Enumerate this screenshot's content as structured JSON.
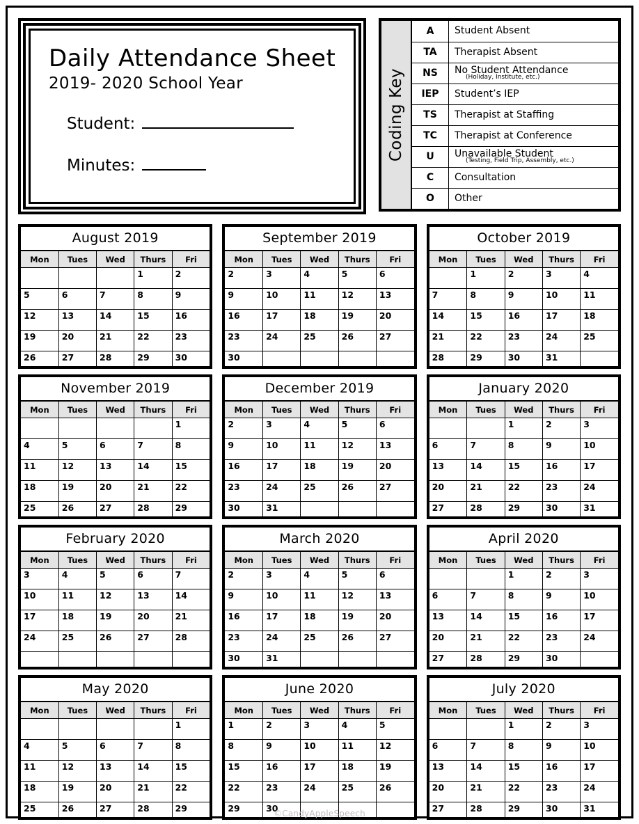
{
  "document": {
    "title": "Daily Attendance Sheet",
    "subtitle": "2019- 2020 School Year",
    "fields": {
      "student_label": "Student:",
      "minutes_label": "Minutes:"
    },
    "footer_credit": "©CandyAppleSpeech"
  },
  "coding_key": {
    "sidebar_label": "Coding Key",
    "rows": [
      {
        "code": "A",
        "description": "Student Absent",
        "sub": ""
      },
      {
        "code": "TA",
        "description": "Therapist Absent",
        "sub": ""
      },
      {
        "code": "NS",
        "description": "No Student Attendance",
        "sub": "(Holiday, Institute, etc.)"
      },
      {
        "code": "IEP",
        "description": "Student’s IEP",
        "sub": ""
      },
      {
        "code": "TS",
        "description": "Therapist at Staffing",
        "sub": ""
      },
      {
        "code": "TC",
        "description": "Therapist at Conference",
        "sub": ""
      },
      {
        "code": "U",
        "description": "Unavailable Student",
        "sub": "(Testing, Field Trip, Assembly, etc.)"
      },
      {
        "code": "C",
        "description": "Consultation",
        "sub": ""
      },
      {
        "code": "O",
        "description": "Other",
        "sub": ""
      }
    ]
  },
  "calendars": {
    "weekday_headers": [
      "Mon",
      "Tues",
      "Wed",
      "Thurs",
      "Fri"
    ],
    "months": [
      {
        "title": "August 2019",
        "weeks": [
          [
            "",
            "",
            "",
            "1",
            "2"
          ],
          [
            "5",
            "6",
            "7",
            "8",
            "9"
          ],
          [
            "12",
            "13",
            "14",
            "15",
            "16"
          ],
          [
            "19",
            "20",
            "21",
            "22",
            "23"
          ],
          [
            "26",
            "27",
            "28",
            "29",
            "30"
          ]
        ]
      },
      {
        "title": "September 2019",
        "weeks": [
          [
            "2",
            "3",
            "4",
            "5",
            "6"
          ],
          [
            "9",
            "10",
            "11",
            "12",
            "13"
          ],
          [
            "16",
            "17",
            "18",
            "19",
            "20"
          ],
          [
            "23",
            "24",
            "25",
            "26",
            "27"
          ],
          [
            "30",
            "",
            "",
            "",
            ""
          ]
        ]
      },
      {
        "title": "October 2019",
        "weeks": [
          [
            "",
            "1",
            "2",
            "3",
            "4"
          ],
          [
            "7",
            "8",
            "9",
            "10",
            "11"
          ],
          [
            "14",
            "15",
            "16",
            "17",
            "18"
          ],
          [
            "21",
            "22",
            "23",
            "24",
            "25"
          ],
          [
            "28",
            "29",
            "30",
            "31",
            ""
          ]
        ]
      },
      {
        "title": "November 2019",
        "weeks": [
          [
            "",
            "",
            "",
            "",
            "1"
          ],
          [
            "4",
            "5",
            "6",
            "7",
            "8"
          ],
          [
            "11",
            "12",
            "13",
            "14",
            "15"
          ],
          [
            "18",
            "19",
            "20",
            "21",
            "22"
          ],
          [
            "25",
            "26",
            "27",
            "28",
            "29"
          ]
        ]
      },
      {
        "title": "December 2019",
        "weeks": [
          [
            "2",
            "3",
            "4",
            "5",
            "6"
          ],
          [
            "9",
            "10",
            "11",
            "12",
            "13"
          ],
          [
            "16",
            "17",
            "18",
            "19",
            "20"
          ],
          [
            "23",
            "24",
            "25",
            "26",
            "27"
          ],
          [
            "30",
            "31",
            "",
            "",
            ""
          ]
        ]
      },
      {
        "title": "January 2020",
        "weeks": [
          [
            "",
            "",
            "1",
            "2",
            "3"
          ],
          [
            "6",
            "7",
            "8",
            "9",
            "10"
          ],
          [
            "13",
            "14",
            "15",
            "16",
            "17"
          ],
          [
            "20",
            "21",
            "22",
            "23",
            "24"
          ],
          [
            "27",
            "28",
            "29",
            "30",
            "31"
          ]
        ]
      },
      {
        "title": "February 2020",
        "weeks": [
          [
            "3",
            "4",
            "5",
            "6",
            "7"
          ],
          [
            "10",
            "11",
            "12",
            "13",
            "14"
          ],
          [
            "17",
            "18",
            "19",
            "20",
            "21"
          ],
          [
            "24",
            "25",
            "26",
            "27",
            "28"
          ],
          [
            "",
            "",
            "",
            "",
            ""
          ]
        ]
      },
      {
        "title": "March 2020",
        "weeks": [
          [
            "2",
            "3",
            "4",
            "5",
            "6"
          ],
          [
            "9",
            "10",
            "11",
            "12",
            "13"
          ],
          [
            "16",
            "17",
            "18",
            "19",
            "20"
          ],
          [
            "23",
            "24",
            "25",
            "26",
            "27"
          ],
          [
            "30",
            "31",
            "",
            "",
            ""
          ]
        ]
      },
      {
        "title": "April 2020",
        "weeks": [
          [
            "",
            "",
            "1",
            "2",
            "3"
          ],
          [
            "6",
            "7",
            "8",
            "9",
            "10"
          ],
          [
            "13",
            "14",
            "15",
            "16",
            "17"
          ],
          [
            "20",
            "21",
            "22",
            "23",
            "24"
          ],
          [
            "27",
            "28",
            "29",
            "30",
            ""
          ]
        ]
      },
      {
        "title": "May 2020",
        "weeks": [
          [
            "",
            "",
            "",
            "",
            "1"
          ],
          [
            "4",
            "5",
            "6",
            "7",
            "8"
          ],
          [
            "11",
            "12",
            "13",
            "14",
            "15"
          ],
          [
            "18",
            "19",
            "20",
            "21",
            "22"
          ],
          [
            "25",
            "26",
            "27",
            "28",
            "29"
          ]
        ]
      },
      {
        "title": "June 2020",
        "weeks": [
          [
            "1",
            "2",
            "3",
            "4",
            "5"
          ],
          [
            "8",
            "9",
            "10",
            "11",
            "12"
          ],
          [
            "15",
            "16",
            "17",
            "18",
            "19"
          ],
          [
            "22",
            "23",
            "24",
            "25",
            "26"
          ],
          [
            "29",
            "30",
            "",
            "",
            ""
          ]
        ]
      },
      {
        "title": "July 2020",
        "weeks": [
          [
            "",
            "",
            "1",
            "2",
            "3"
          ],
          [
            "6",
            "7",
            "8",
            "9",
            "10"
          ],
          [
            "13",
            "14",
            "15",
            "16",
            "17"
          ],
          [
            "20",
            "21",
            "22",
            "23",
            "24"
          ],
          [
            "27",
            "28",
            "29",
            "30",
            "31"
          ]
        ]
      }
    ]
  }
}
